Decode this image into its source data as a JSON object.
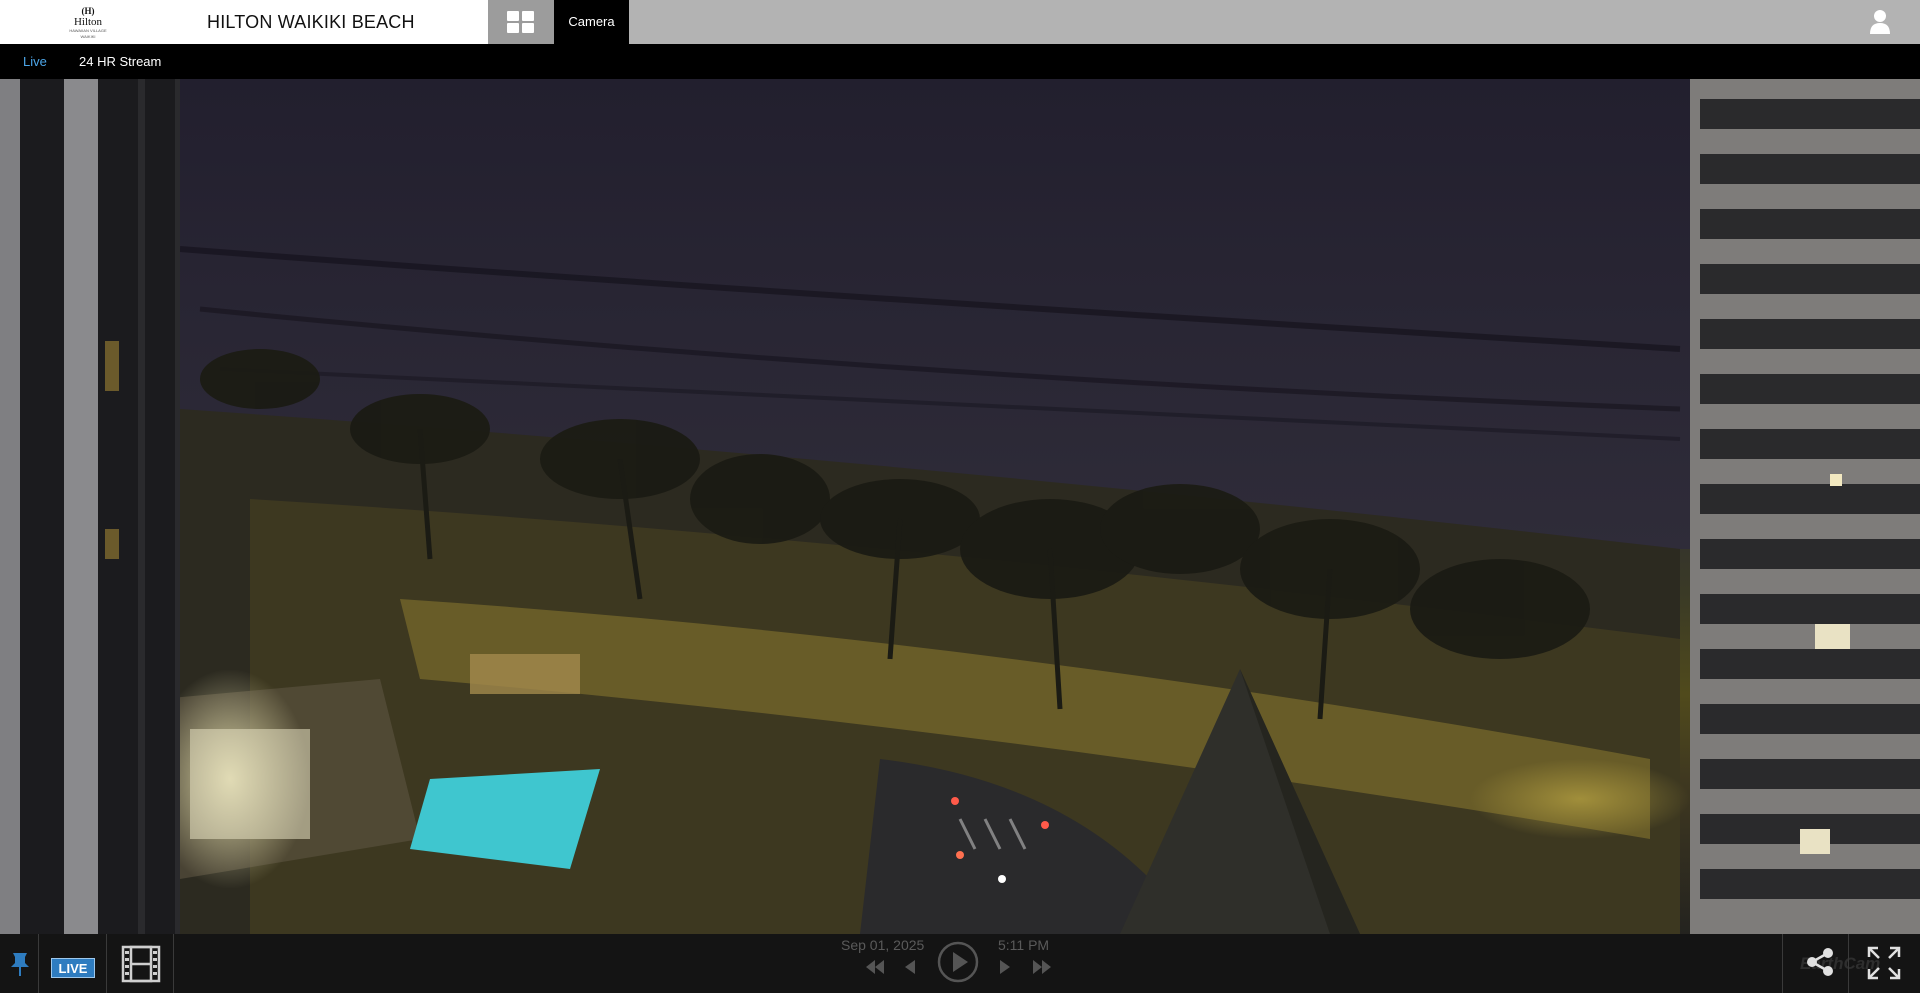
{
  "header": {
    "logo": {
      "mark": "(H)",
      "word": "Hilton",
      "tagline": "HAWAIIAN VILLAGE WAIKIKI"
    },
    "title": "HILTON WAIKIKI BEACH",
    "tab_camera": "Camera",
    "icons": {
      "grid": "grid-icon",
      "user": "user-icon"
    }
  },
  "subnav": {
    "tabs": [
      {
        "label": "Live",
        "active": true
      },
      {
        "label": "24 HR Stream",
        "active": false
      }
    ]
  },
  "player": {
    "live_badge": "LIVE",
    "date": "Sep 01, 2025",
    "time": "5:11 PM",
    "watermark": "EarthCam",
    "icons": [
      "pin-icon",
      "film-icon",
      "skip-back-icon",
      "step-back-icon",
      "play-icon",
      "step-forward-icon",
      "skip-forward-icon",
      "share-icon",
      "fullscreen-icon"
    ]
  },
  "colors": {
    "accent": "#2e7cc0",
    "active_tab": "#4da6e8",
    "header_bg": "#b3b3b3"
  }
}
